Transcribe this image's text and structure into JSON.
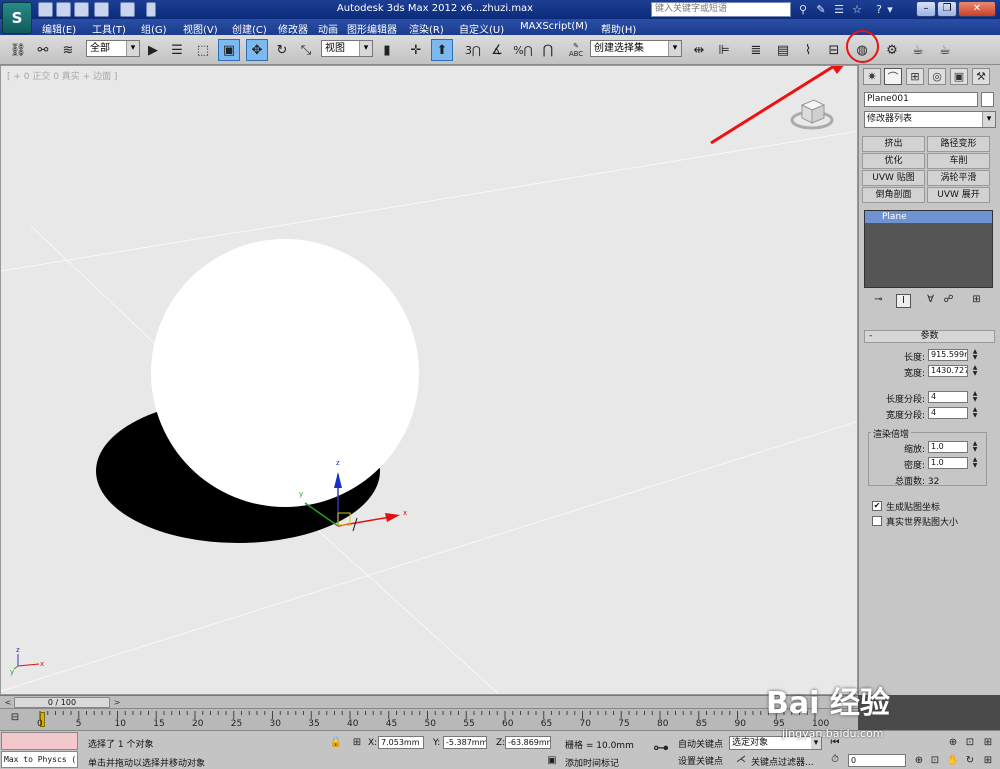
{
  "app": {
    "logo": "S",
    "title": "Autodesk 3ds Max  2012 x6...zhuzi.max",
    "search_placeholder": "键入关键字或短语"
  },
  "menu": [
    "编辑(E)",
    "工具(T)",
    "组(G)",
    "视图(V)",
    "创建(C)",
    "修改器",
    "动画",
    "图形编辑器",
    "渲染(R)",
    "自定义(U)",
    "MAXScript(M)",
    "帮助(H)"
  ],
  "toolbar": {
    "selection_filter": "全部",
    "reference_coord": "视图",
    "named_selection": "创建选择集",
    "snap_value": "3",
    "percent_label": "%",
    "abc_label": "ABC"
  },
  "viewport": {
    "label": "[ + 0 正交 0 真实 + 边面 ]"
  },
  "command_panel": {
    "object_name": "Plane001",
    "modifier_list": "修改器列表",
    "modifier_buttons": [
      "挤出",
      "路径变形",
      "优化",
      "车削",
      "UVW 贴图",
      "涡轮平滑",
      "倒角剖面",
      "UVW 展开"
    ],
    "stack_item": "Plane",
    "rollout_title": "参数",
    "rollout_toggle": "-",
    "params": {
      "length_label": "长度:",
      "length_value": "915.599m",
      "width_label": "宽度:",
      "width_value": "1430.727r",
      "length_segs_label": "长度分段:",
      "length_segs_value": "4",
      "width_segs_label": "宽度分段:",
      "width_segs_value": "4"
    },
    "render_multipliers": {
      "title": "渲染倍增",
      "scale_label": "缩放:",
      "scale_value": "1.0",
      "density_label": "密度:",
      "density_value": "1.0",
      "total_faces": "总面数: 32"
    },
    "gen_map_coords": "生成贴图坐标",
    "real_world_map": "真实世界贴图大小",
    "gen_map_coords_checked": true,
    "real_world_map_checked": false
  },
  "timeline": {
    "frame_display": "0 / 100",
    "ticks": [
      "0",
      "5",
      "10",
      "15",
      "20",
      "25",
      "30",
      "35",
      "40",
      "45",
      "50",
      "55",
      "60",
      "65",
      "70",
      "75",
      "80",
      "85",
      "90",
      "95",
      "100"
    ]
  },
  "status": {
    "maxscript_listener": "Max to Physcs (",
    "selection_info": "选择了 1 个对象",
    "prompt": "单击并拖动以选择并移动对象",
    "x_label": "X:",
    "x_value": "7.053mm",
    "y_label": "Y:",
    "y_value": "-5.387mm",
    "z_label": "Z:",
    "z_value": "-63.869mm",
    "grid": "栅格 = 10.0mm",
    "auto_key": "自动关键点",
    "set_key": "设置关键点",
    "key_mode_dropdown": "选定对象",
    "key_filters": "关键点过滤器...",
    "add_time_tag": "添加时间标记",
    "frame_field": "0"
  },
  "watermark": {
    "brand": "Bai 经验",
    "url": "jingyan.baidu.com"
  },
  "colors": {
    "title_bar": "#1d3f93",
    "viewport_bg": "#e8e8e8",
    "annotation_red": "#e11111",
    "stack_highlight": "#6f92d3",
    "maxscript_pink": "#f2c8cd"
  }
}
